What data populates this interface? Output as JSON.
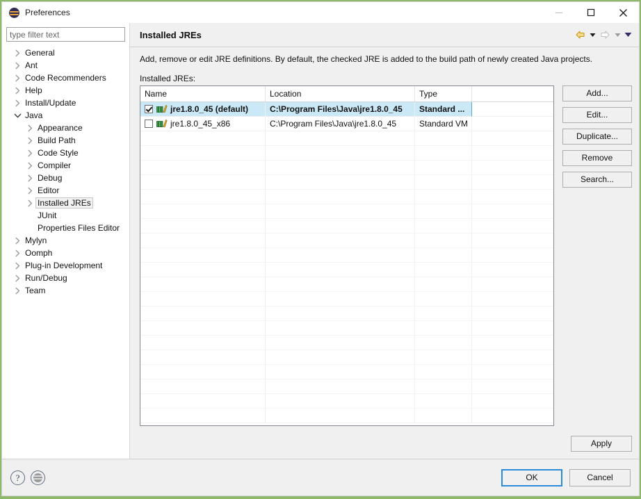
{
  "window": {
    "title": "Preferences",
    "app_icon": "eclipse-icon",
    "controls": {
      "minimize": "minimize-icon",
      "maximize": "maximize-icon",
      "close": "close-icon"
    }
  },
  "sidebar": {
    "filter_placeholder": "type filter text",
    "filter_value": "",
    "items": [
      {
        "label": "General",
        "depth": 0,
        "arrow": "collapsed",
        "selected": false
      },
      {
        "label": "Ant",
        "depth": 0,
        "arrow": "collapsed",
        "selected": false
      },
      {
        "label": "Code Recommenders",
        "depth": 0,
        "arrow": "collapsed",
        "selected": false
      },
      {
        "label": "Help",
        "depth": 0,
        "arrow": "collapsed",
        "selected": false
      },
      {
        "label": "Install/Update",
        "depth": 0,
        "arrow": "collapsed",
        "selected": false
      },
      {
        "label": "Java",
        "depth": 0,
        "arrow": "expanded",
        "selected": false
      },
      {
        "label": "Appearance",
        "depth": 1,
        "arrow": "collapsed",
        "selected": false
      },
      {
        "label": "Build Path",
        "depth": 1,
        "arrow": "collapsed",
        "selected": false
      },
      {
        "label": "Code Style",
        "depth": 1,
        "arrow": "collapsed",
        "selected": false
      },
      {
        "label": "Compiler",
        "depth": 1,
        "arrow": "collapsed",
        "selected": false
      },
      {
        "label": "Debug",
        "depth": 1,
        "arrow": "collapsed",
        "selected": false
      },
      {
        "label": "Editor",
        "depth": 1,
        "arrow": "collapsed",
        "selected": false
      },
      {
        "label": "Installed JREs",
        "depth": 1,
        "arrow": "collapsed",
        "selected": true
      },
      {
        "label": "JUnit",
        "depth": 1,
        "arrow": "none",
        "selected": false
      },
      {
        "label": "Properties Files Editor",
        "depth": 1,
        "arrow": "none",
        "selected": false
      },
      {
        "label": "Mylyn",
        "depth": 0,
        "arrow": "collapsed",
        "selected": false
      },
      {
        "label": "Oomph",
        "depth": 0,
        "arrow": "collapsed",
        "selected": false
      },
      {
        "label": "Plug-in Development",
        "depth": 0,
        "arrow": "collapsed",
        "selected": false
      },
      {
        "label": "Run/Debug",
        "depth": 0,
        "arrow": "collapsed",
        "selected": false
      },
      {
        "label": "Team",
        "depth": 0,
        "arrow": "collapsed",
        "selected": false
      }
    ]
  },
  "page": {
    "title": "Installed JREs",
    "description": "Add, remove or edit JRE definitions. By default, the checked JRE is added to the build path of newly created Java projects.",
    "section_label": "Installed JREs:",
    "nav": {
      "back": "back-arrow-icon",
      "back_menu": "back-dropdown-icon",
      "forward": "forward-arrow-icon",
      "forward_menu": "forward-dropdown-icon",
      "view_menu": "view-menu-icon",
      "back_color": "#e8b23a",
      "forward_color": "#c9c9c9",
      "menu_color": "#3b2a6b"
    }
  },
  "table": {
    "columns": [
      "Name",
      "Location",
      "Type"
    ],
    "rows": [
      {
        "checked": true,
        "icon": "jre-icon",
        "name": "jre1.8.0_45 (default)",
        "location": "C:\\Program Files\\Java\\jre1.8.0_45",
        "type": "Standard ...",
        "selected": true
      },
      {
        "checked": false,
        "icon": "jre-icon",
        "name": "jre1.8.0_45_x86",
        "location": "C:\\Program Files\\Java\\jre1.8.0_45",
        "type": "Standard VM",
        "selected": false
      }
    ],
    "empty_row_count": 20
  },
  "side_buttons": [
    {
      "label": "Add...",
      "name": "add-button"
    },
    {
      "label": "Edit...",
      "name": "edit-button"
    },
    {
      "label": "Duplicate...",
      "name": "duplicate-button"
    },
    {
      "label": "Remove",
      "name": "remove-button"
    },
    {
      "label": "Search...",
      "name": "search-button"
    }
  ],
  "apply": {
    "label": "Apply"
  },
  "footer": {
    "help_icon": "help-icon",
    "eclipse_icon": "eclipse-gray-icon",
    "ok_label": "OK",
    "cancel_label": "Cancel"
  }
}
